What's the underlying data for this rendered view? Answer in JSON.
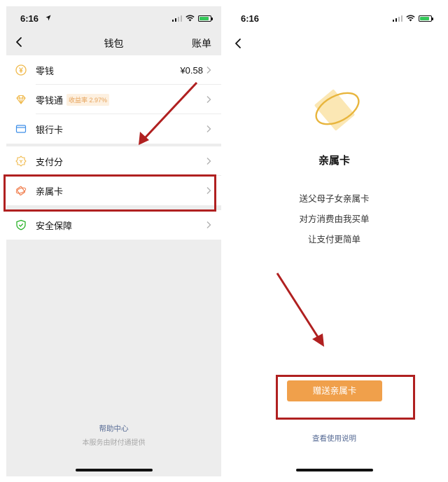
{
  "left": {
    "status": {
      "time": "6:16"
    },
    "nav": {
      "title": "钱包",
      "right": "账单"
    },
    "rows_group1": [
      {
        "label": "零钱",
        "value": "¥0.58",
        "icon": "yuan-coin-icon"
      },
      {
        "label": "零钱通",
        "badge": "收益率 2.97%",
        "icon": "diamond-icon"
      },
      {
        "label": "银行卡",
        "icon": "bank-card-icon"
      }
    ],
    "rows_group2": [
      {
        "label": "支付分",
        "icon": "pay-score-icon"
      },
      {
        "label": "亲属卡",
        "icon": "family-card-icon"
      }
    ],
    "rows_group3": [
      {
        "label": "安全保障",
        "icon": "shield-icon"
      }
    ],
    "footer": {
      "help": "帮助中心",
      "note": "本服务由财付通提供"
    }
  },
  "right": {
    "status": {
      "time": "6:16"
    },
    "title": "亲属卡",
    "lines": [
      "送父母子女亲属卡",
      "对方消费由我买单",
      "让支付更简单"
    ],
    "button": "赠送亲属卡",
    "link": "查看使用说明"
  },
  "colors": {
    "accent": "#f0a04b",
    "link": "#576b95",
    "annotation": "#b02020",
    "positive": "#34c759"
  }
}
